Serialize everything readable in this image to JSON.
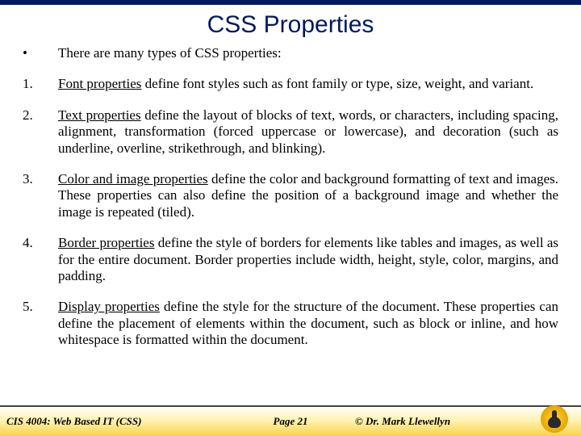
{
  "title": "CSS Properties",
  "intro_marker": "•",
  "intro_text": "There are many types of CSS properties:",
  "items": [
    {
      "n": "1.",
      "lead": "Font properties",
      "rest": " define font styles such as font family or type, size, weight, and variant."
    },
    {
      "n": "2.",
      "lead": "Text properties",
      "rest": " define the layout of blocks of text, words, or characters, including spacing, alignment, transformation (forced uppercase or lowercase), and decoration (such as underline, overline, strikethrough, and blinking)."
    },
    {
      "n": "3.",
      "lead": "Color and image properties",
      "rest": " define the color and background formatting of text and images.  These properties can also define the position of a background image and whether the image is repeated (tiled)."
    },
    {
      "n": "4.",
      "lead": "Border properties",
      "rest": " define the style of borders for elements like tables and images, as well as for the entire document.  Border properties include width, height, style, color, margins, and padding."
    },
    {
      "n": "5.",
      "lead": "Display properties",
      "rest": " define the style for the structure of the document.  These properties can define the placement of elements within the document, such as block or inline, and how whitespace is formatted within the document."
    }
  ],
  "footer": {
    "left": "CIS 4004: Web Based IT (CSS)",
    "center": "Page 21",
    "right": "© Dr. Mark Llewellyn"
  }
}
